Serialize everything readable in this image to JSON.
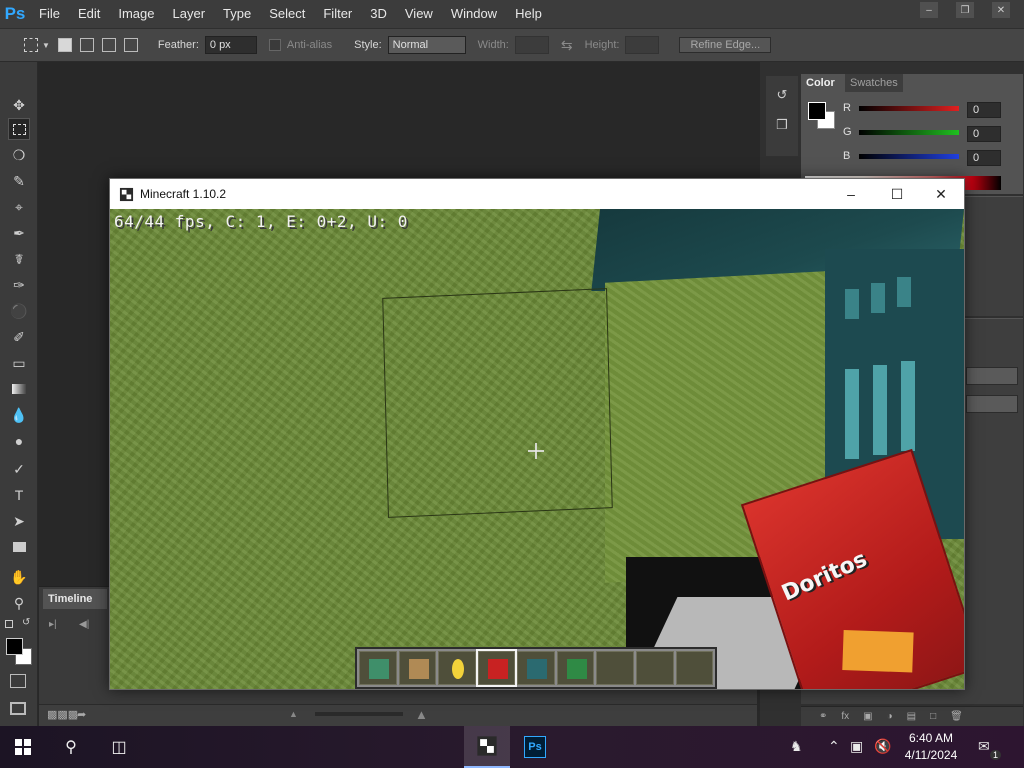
{
  "photoshop": {
    "logo": "Ps",
    "menu": [
      "File",
      "Edit",
      "Image",
      "Layer",
      "Type",
      "Select",
      "Filter",
      "3D",
      "View",
      "Window",
      "Help"
    ],
    "options": {
      "feather_label": "Feather:",
      "feather_value": "0 px",
      "antialias_label": "Anti-alias",
      "style_label": "Style:",
      "style_value": "Normal",
      "width_label": "Width:",
      "height_label": "Height:",
      "refine_label": "Refine Edge..."
    },
    "color_panel": {
      "tab_color": "Color",
      "tab_swatches": "Swatches",
      "channels": [
        {
          "name": "R",
          "value": "0",
          "color": "#e02020"
        },
        {
          "name": "G",
          "value": "0",
          "color": "#20c020"
        },
        {
          "name": "B",
          "value": "0",
          "color": "#2040e0"
        }
      ]
    },
    "timeline": {
      "tab_label": "Timeline"
    }
  },
  "minecraft": {
    "window_title": "Minecraft 1.10.2",
    "debug_text": "64/44 fps, C: 1, E: 0+2, U: 0",
    "hotbar": [
      {
        "icon": "enchanted-book-icon",
        "color": "#3f8f6a"
      },
      {
        "icon": "book-icon",
        "color": "#b08a55"
      },
      {
        "icon": "gold-coin-icon",
        "color": "#f2d23a"
      },
      {
        "icon": "red-chips-bag-icon",
        "color": "#c82222",
        "selected": true
      },
      {
        "icon": "teal-block-icon",
        "color": "#2b6a70"
      },
      {
        "icon": "green-ore-icon",
        "color": "#2f8a45"
      },
      {
        "icon": "empty-slot",
        "color": ""
      },
      {
        "icon": "empty-slot",
        "color": ""
      },
      {
        "icon": "empty-slot",
        "color": ""
      }
    ],
    "held_item_text": "Doritos"
  },
  "taskbar": {
    "time": "6:40 AM",
    "date": "4/11/2024",
    "notification_count": "1",
    "ps_label": "Ps"
  }
}
